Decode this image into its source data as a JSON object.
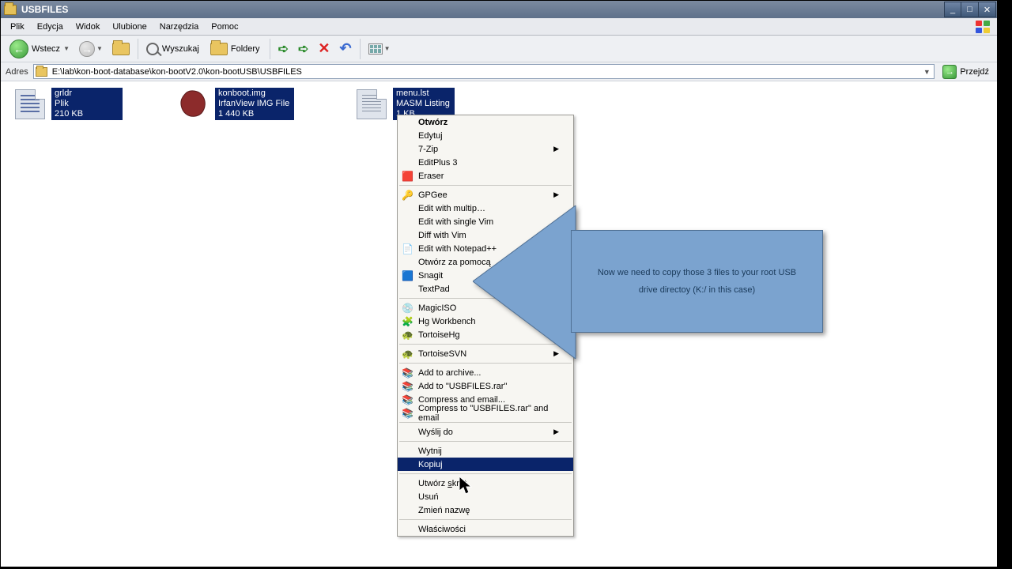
{
  "titlebar": {
    "title": "USBFILES"
  },
  "window_controls": {
    "minimize": "_",
    "maximize": "□",
    "close": "✕"
  },
  "menubar": {
    "items": [
      "Plik",
      "Edycja",
      "Widok",
      "Ulubione",
      "Narzędzia",
      "Pomoc"
    ]
  },
  "toolbar": {
    "back": "Wstecz",
    "search": "Wyszukaj",
    "folders": "Foldery"
  },
  "addressbar": {
    "label": "Adres",
    "path": "E:\\lab\\kon-boot-database\\kon-bootV2.0\\kon-bootUSB\\USBFILES",
    "go": "Przejdź"
  },
  "files": [
    {
      "name": "grldr",
      "type": "Plik",
      "size": "210 KB"
    },
    {
      "name": "konboot.img",
      "type": "IrfanView IMG File",
      "size": "1 440 KB"
    },
    {
      "name": "menu.lst",
      "type": "MASM Listing",
      "size": "1 KB"
    }
  ],
  "contextmenu": {
    "items": [
      {
        "label": "Otwórz",
        "bold": true
      },
      {
        "label": "Edytuj"
      },
      {
        "label": "7-Zip",
        "sub": true
      },
      {
        "label": "EditPlus 3"
      },
      {
        "label": "Eraser",
        "icon": "🟥"
      },
      {
        "sep": true
      },
      {
        "label": "GPGee",
        "icon": "🔑",
        "sub": true
      },
      {
        "label": "Edit with multip…"
      },
      {
        "label": "Edit with single Vim"
      },
      {
        "label": "Diff with Vim"
      },
      {
        "label": "Edit with Notepad++",
        "icon": "📄"
      },
      {
        "label": "Otwórz za pomocą"
      },
      {
        "label": "Snagit",
        "icon": "🟦",
        "sub": true
      },
      {
        "label": "TextPad"
      },
      {
        "sep": true
      },
      {
        "label": "MagicISO",
        "icon": "💿",
        "sub": true
      },
      {
        "label": "Hg Workbench",
        "icon": "🧩"
      },
      {
        "label": "TortoiseHg",
        "icon": "🐢",
        "sub": true
      },
      {
        "sep": true
      },
      {
        "label": "TortoiseSVN",
        "icon": "🐢",
        "sub": true
      },
      {
        "sep": true
      },
      {
        "label": "Add to archive...",
        "icon": "📚"
      },
      {
        "label": "Add to \"USBFILES.rar\"",
        "icon": "📚"
      },
      {
        "label": "Compress and email...",
        "icon": "📚"
      },
      {
        "label": "Compress to \"USBFILES.rar\" and email",
        "icon": "📚"
      },
      {
        "sep": true
      },
      {
        "label": "Wyślij do",
        "sub": true
      },
      {
        "sep": true
      },
      {
        "label": "Wytnij"
      },
      {
        "label": "Kopiuj",
        "hi": true
      },
      {
        "sep": true
      },
      {
        "label": "Utwórz skrót",
        "ul": "s"
      },
      {
        "label": "Usuń"
      },
      {
        "label": "Zmień nazwę"
      },
      {
        "sep": true
      },
      {
        "label": "Właściwości"
      }
    ]
  },
  "callout": {
    "text": "Now we need to copy those 3 files to your root USB drive directoy (K:/ in this case)"
  }
}
